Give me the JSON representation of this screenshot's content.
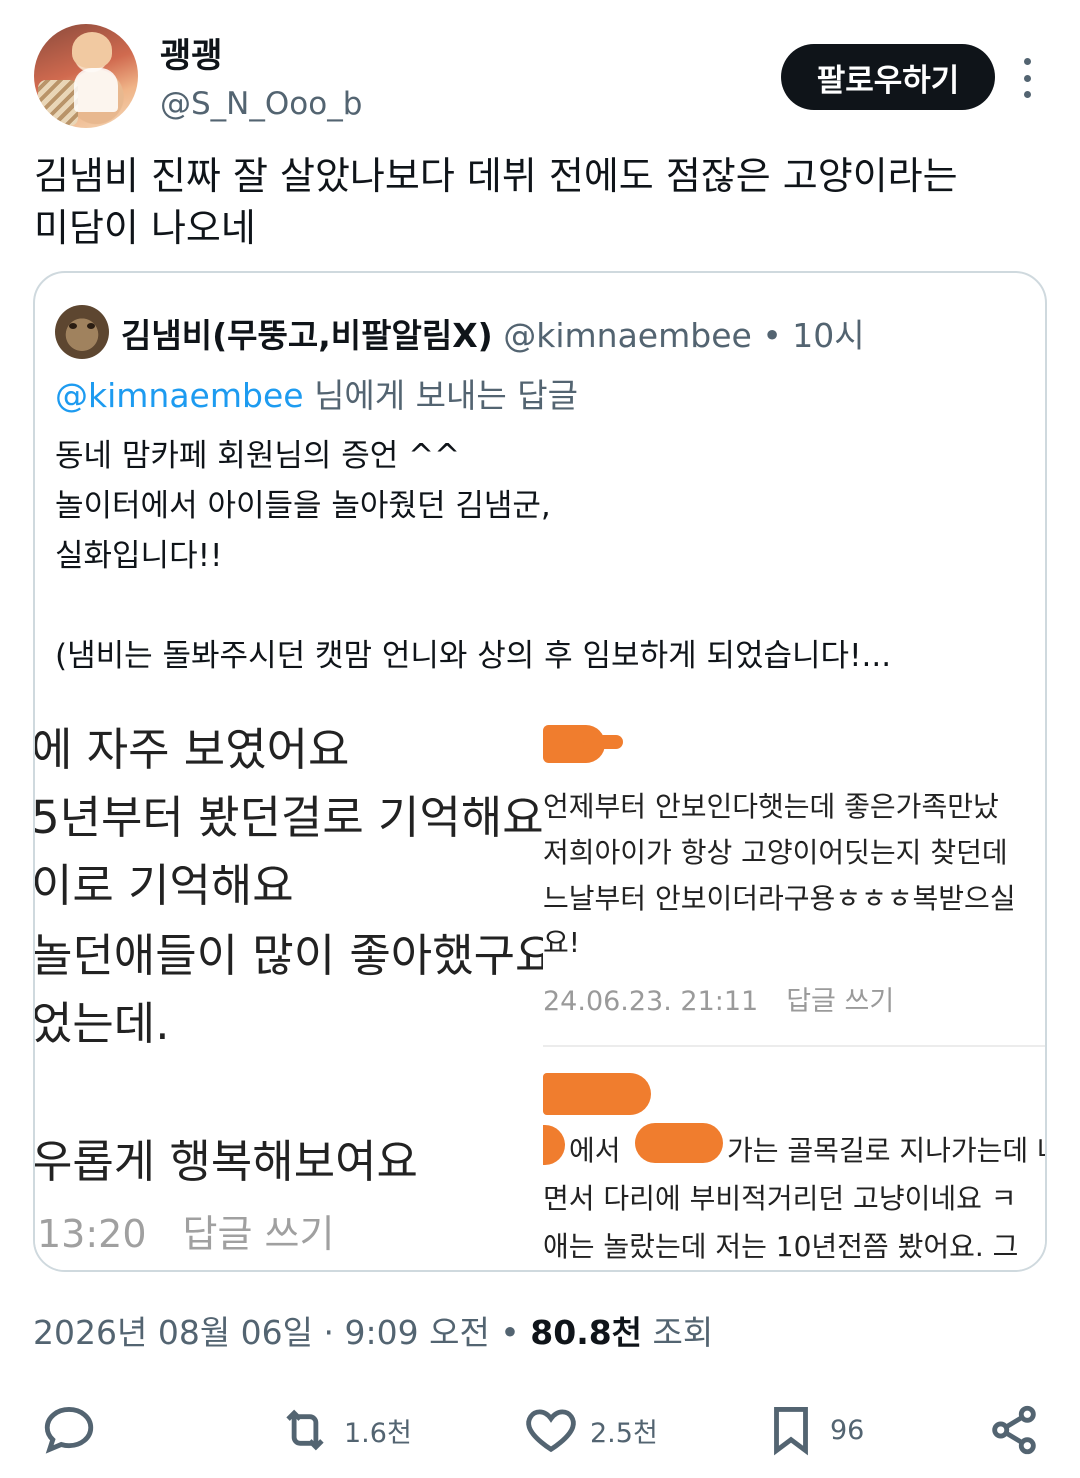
{
  "author": {
    "display_name": "괭괭",
    "handle": "@S_N_Ooo_b",
    "avatar_icon": "profile-photo"
  },
  "follow_button": "팔로우하기",
  "more_icon": "more-vertical-icon",
  "tweet": {
    "line1": "김냄비 진짜 잘 살았나보다 데뷔 전에도 점잖은 고양이라는",
    "line2": "미담이 나오네"
  },
  "quote": {
    "name": "김냄비(무뚱고,비팔알림X)",
    "handle": "@kimnaembee",
    "separator": " • ",
    "time": "10시",
    "reply_to_mention": "@kimnaembee",
    "reply_to_suffix": " 님에게 보내는 답글",
    "body": [
      "동네 맘카페 회원님의 증언 ^^",
      "놀이터에서 아이들을 놀아줬던 김냄군,",
      "실화입니다!!"
    ],
    "body_last": "(냄비는 돌봐주시던 캣맘 언니와 상의 후 임보하게 되었습니다!...",
    "screenshot_left": {
      "lines": [
        "에 자주 보였어요",
        "5년부터 봤던걸로 기억해요.",
        "이로 기억해요",
        "놀던애들이 많이 좋아했구요",
        "었는데.",
        "우롭게 행복해보여요"
      ],
      "time": "13:20",
      "reply_label": "답글 쓰기"
    },
    "screenshot_right": {
      "lines": [
        "언제부터 안보인다햇는데 좋은가족만났",
        "저희아이가 항상 고양이어딧는지 찾던데",
        "느날부터 안보이더라구용ㅎㅎㅎ복받으실",
        "요!"
      ],
      "meta_date": "24.06.23. 21:11",
      "reply_label": "답글 쓰기",
      "lines2": [
        "에서",
        "가는 골목길로 지나가는데 나",
        "면서 다리에 부비적거리던 고냥이네요 ㅋ",
        "애는 놀랐는데 저는 10년전쯤 봤어요. 그"
      ],
      "redaction_color": "#f07d2e"
    }
  },
  "meta": {
    "datetime": "2026년 08월 06일 · 9:09 오전",
    "dot": " • ",
    "views_count": "80.8천",
    "views_label": " 조회"
  },
  "actions": {
    "reply": {
      "icon": "reply-icon"
    },
    "retweet": {
      "icon": "retweet-icon",
      "count": "1.6천"
    },
    "like": {
      "icon": "like-icon",
      "count": "2.5천"
    },
    "bookmark": {
      "icon": "bookmark-icon",
      "count": "96"
    },
    "share": {
      "icon": "share-icon"
    }
  }
}
